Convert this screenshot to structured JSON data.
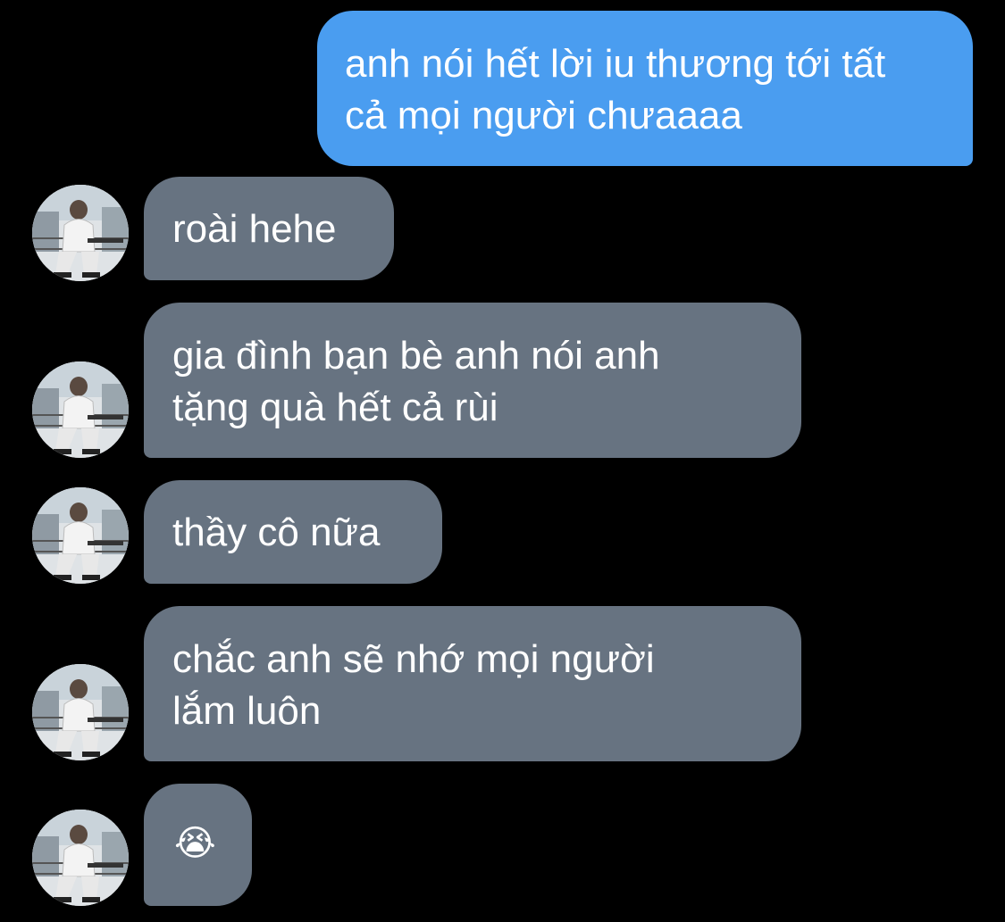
{
  "conversation": {
    "messages": [
      {
        "sender": "me",
        "lines": [
          "anh nói hết lời iu thương tới tất",
          "cả mọi người chưaaaa"
        ]
      },
      {
        "sender": "other",
        "lines": [
          "roài hehe"
        ]
      },
      {
        "sender": "other",
        "lines": [
          "gia đình bạn bè anh nói anh",
          "tặng quà hết cả rùi"
        ]
      },
      {
        "sender": "other",
        "lines": [
          "thầy cô nữa"
        ]
      },
      {
        "sender": "other",
        "lines": [
          "chắc anh sẽ nhớ mọi người",
          "lắm luôn"
        ]
      },
      {
        "sender": "other",
        "lines": [
          "😭"
        ]
      }
    ]
  },
  "colors": {
    "background": "#000000",
    "outgoing_bubble": "#4a9df0",
    "incoming_bubble": "#677381",
    "text": "#ffffff"
  }
}
